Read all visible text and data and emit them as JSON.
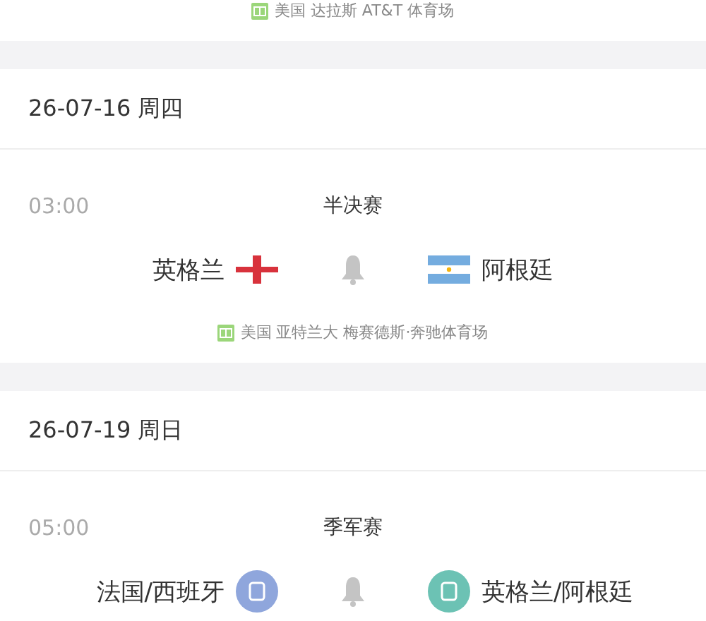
{
  "top_venue": "美国 达拉斯 AT&T 体育场",
  "days": [
    {
      "date": "26-07-16 周四",
      "matches": [
        {
          "time": "03:00",
          "round": "半决赛",
          "home": {
            "name": "英格兰",
            "badge": {
              "kind": "england"
            }
          },
          "away": {
            "name": "阿根廷",
            "badge": {
              "kind": "argentina"
            }
          },
          "venue": "美国 亚特兰大 梅赛德斯·奔驰体育场"
        }
      ]
    },
    {
      "date": "26-07-19 周日",
      "matches": [
        {
          "time": "05:00",
          "round": "季军赛",
          "home": {
            "name": "法国/西班牙",
            "badge": {
              "kind": "circle",
              "color": "#8fa6dc"
            }
          },
          "away": {
            "name": "英格兰/阿根廷",
            "badge": {
              "kind": "circle",
              "color": "#6cc2b4"
            }
          }
        }
      ]
    }
  ]
}
